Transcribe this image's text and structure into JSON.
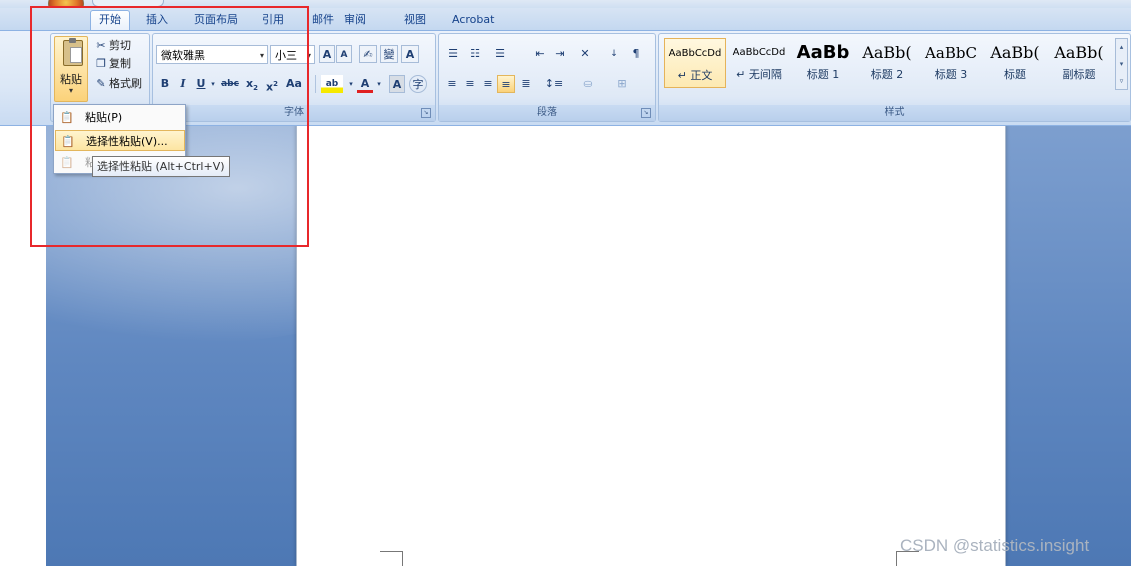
{
  "window": {
    "title": ""
  },
  "tabs": [
    {
      "label": "开始"
    },
    {
      "label": "插入"
    },
    {
      "label": "页面布局"
    },
    {
      "label": "引用"
    },
    {
      "label": "邮件"
    },
    {
      "label": "审阅"
    },
    {
      "label": "视图"
    },
    {
      "label": "Acrobat"
    }
  ],
  "clipboard": {
    "paste_label": "粘贴",
    "cut_label": "剪切",
    "copy_label": "复制",
    "format_painter_label": "格式刷"
  },
  "font": {
    "group_label": "字体",
    "font_name": "微软雅黑",
    "font_size": "小三"
  },
  "paragraph": {
    "group_label": "段落"
  },
  "styles": {
    "group_label": "样式",
    "items": [
      {
        "sample": "AaBbCcDd",
        "name": "↵ 正文"
      },
      {
        "sample": "AaBbCcDd",
        "name": "↵ 无间隔"
      },
      {
        "sample": "AaBb",
        "name": "标题 1"
      },
      {
        "sample": "AaBb(",
        "name": "标题 2"
      },
      {
        "sample": "AaBbC",
        "name": "标题 3"
      },
      {
        "sample": "AaBb(",
        "name": "标题"
      },
      {
        "sample": "AaBb(",
        "name": "副标题"
      }
    ]
  },
  "paste_menu": {
    "items": [
      {
        "label": "粘贴(P)"
      },
      {
        "label": "选择性粘贴(V)..."
      },
      {
        "label": "粘"
      }
    ],
    "tooltip": "选择性粘贴 (Alt+Ctrl+V)"
  },
  "watermark": "CSDN @statistics.insight",
  "colors": {
    "highlight_box": "#e8282b",
    "ribbon": "#dbe7f6",
    "desktop": "#5f87c0"
  }
}
